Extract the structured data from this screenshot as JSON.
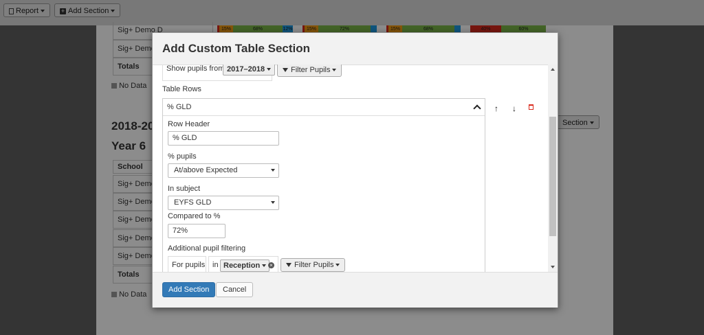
{
  "toolbar": {
    "report_label": "Report",
    "add_section_label": "Add Section"
  },
  "background": {
    "top_rows": [
      "Sig+ Demo D",
      "Sig+ Demo"
    ],
    "totals_label": "Totals",
    "no_data_label": "No Data",
    "bars": [
      [
        "15%",
        "68%",
        "12%"
      ],
      [
        "15%",
        "72%"
      ],
      [
        "15%",
        "68%"
      ],
      [
        "40%",
        "60%"
      ]
    ],
    "year_heading": "2018-20",
    "year_sub": "Year 6",
    "school_header": "School",
    "lower_rows": [
      "Sig+ Demo",
      "Sig+ Demo",
      "Sig+ Demo",
      "Sig+ Demo",
      "Sig+ Demo"
    ],
    "totals_label2": "Totals",
    "no_data_label2": "No Data",
    "section_button": "Section"
  },
  "modal": {
    "title": "Add Custom Table Section",
    "show_pupils_from_label": "Show pupils from",
    "show_pupils_from_value": "2017–2018",
    "filter_pupils_label": "Filter Pupils",
    "table_rows_label": "Table Rows",
    "row": {
      "title": "% GLD",
      "row_header_label": "Row Header",
      "row_header_value": "% GLD",
      "pct_pupils_label": "% pupils",
      "pct_pupils_value": "At/above Expected",
      "in_subject_label": "In subject",
      "in_subject_value": "EYFS GLD",
      "compared_to_label": "Compared to %",
      "compared_to_value": "72%",
      "additional_filter_label": "Additional pupil filtering",
      "for_pupils_label": "For pupils",
      "in_label": "in",
      "reception_value": "Reception",
      "filter_pupils_label": "Filter Pupils"
    },
    "add_section_button": "Add Section",
    "cancel_button": "Cancel"
  },
  "colors": {
    "primary": "#337ab7",
    "red": "#d9291c",
    "green": "#7ab648",
    "orange": "#f39c12",
    "blue": "#1e9be4"
  }
}
